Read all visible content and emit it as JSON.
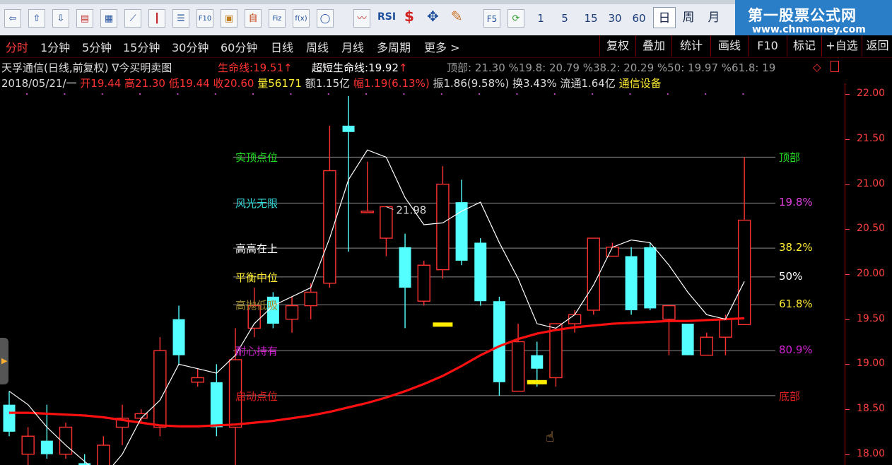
{
  "toolbar": {
    "periods_num": [
      "1",
      "5",
      "15",
      "30",
      "60"
    ],
    "periods_cn": [
      "日",
      "周",
      "月"
    ],
    "rsi_label": "RSI",
    "f5_label": "F5"
  },
  "logo": {
    "title": "第一股票公式网",
    "url": "www.chnmoney.com"
  },
  "periodbar": {
    "items": [
      "分时",
      "1分钟",
      "5分钟",
      "15分钟",
      "30分钟",
      "60分钟",
      "日线",
      "周线",
      "月线",
      "多周期",
      "更多 >"
    ],
    "right": [
      "复权",
      "叠加",
      "统计",
      "画线",
      "F10",
      "标记",
      "+自选",
      "返回"
    ]
  },
  "info1": {
    "name": "天孚通信(日线,前复权)",
    "indicator": "∇今买明卖图",
    "life_label": "生命线:",
    "life_value": "19.51",
    "short_label": "超短生命线:",
    "short_value": "19.92",
    "levels_text": "顶部: 21.30 %19.8: 20.79 %38.2: 20.29 %50: 19.97 %61.8: 19"
  },
  "info2": {
    "date": "2018/05/21/一",
    "open": "开19.44",
    "high": "高21.30",
    "low": "低19.44",
    "close": "收20.60",
    "vol": "量56171",
    "amount": "额1.15亿",
    "change": "幅1.19(6.13%)",
    "amp": "振1.86(9.58%)",
    "turn": "换3.43%",
    "float": "流通1.64亿",
    "sector": "通信设备"
  },
  "axis": {
    "ticks": [
      "22.00",
      "21.50",
      "21.00",
      "20.50",
      "20.00",
      "19.50",
      "19.00",
      "18.50",
      "18.00"
    ]
  },
  "levels": [
    {
      "left": "实顶点位",
      "right": "顶部",
      "price": 21.3,
      "lcolor": "#22dd22",
      "rcolor": "#22dd22"
    },
    {
      "left": "风光无限",
      "right": "19.8%",
      "price": 20.79,
      "lcolor": "#33dddd",
      "rcolor": "#e040e0"
    },
    {
      "left": "高高在上",
      "right": "38.2%",
      "price": 20.29,
      "lcolor": "#ffffff",
      "rcolor": "#ffee33"
    },
    {
      "left": "平衡中位",
      "right": "50%",
      "price": 19.97,
      "lcolor": "#ffee33",
      "rcolor": "#ffffff"
    },
    {
      "left": "高抛低吸",
      "right": "61.8%",
      "price": 19.66,
      "lcolor": "#a08a30",
      "rcolor": "#ffee33"
    },
    {
      "left": "耐心持有",
      "right": "80.9%",
      "price": 19.15,
      "lcolor": "#d020d0",
      "rcolor": "#d020d0"
    },
    {
      "left": "启动点位",
      "right": "底部",
      "price": 18.65,
      "lcolor": "#e02020",
      "rcolor": "#e02020"
    }
  ],
  "peak_label": "21.98",
  "colors": {
    "up": "#ff3232",
    "down": "#54ffff",
    "life": "#ff1010",
    "short": "#ffffff"
  },
  "chart_data": {
    "type": "candlestick",
    "ylim": [
      17.88,
      22.12
    ],
    "candles": [
      [
        18.55,
        18.25,
        18.7,
        18.2
      ],
      [
        18.0,
        18.2,
        18.3,
        17.88
      ],
      [
        18.15,
        18.0,
        18.55,
        17.95
      ],
      [
        18.0,
        18.3,
        18.35,
        17.95
      ],
      [
        17.9,
        17.7,
        18.0,
        17.6
      ],
      [
        17.8,
        18.1,
        18.2,
        17.7
      ],
      [
        18.3,
        18.4,
        18.55,
        18.1
      ],
      [
        18.4,
        18.45,
        18.5,
        18.35
      ],
      [
        18.3,
        19.15,
        19.3,
        18.2
      ],
      [
        19.5,
        19.1,
        19.65,
        19.0
      ],
      [
        18.8,
        18.85,
        18.95,
        18.75
      ],
      [
        18.8,
        18.3,
        19.0,
        18.2
      ],
      [
        18.3,
        19.05,
        19.4,
        17.85
      ],
      [
        19.4,
        19.65,
        19.85,
        19.3
      ],
      [
        19.75,
        19.45,
        19.8,
        19.4
      ],
      [
        19.5,
        19.65,
        19.75,
        19.35
      ],
      [
        19.65,
        19.8,
        19.9,
        19.5
      ],
      [
        19.9,
        21.15,
        21.65,
        19.85
      ],
      [
        21.65,
        21.58,
        21.98,
        20.25
      ],
      [
        20.7,
        20.7,
        21.25,
        20.7
      ],
      [
        20.4,
        20.75,
        20.75,
        20.2
      ],
      [
        20.3,
        19.85,
        20.45,
        19.4
      ],
      [
        19.7,
        20.1,
        20.15,
        19.65
      ],
      [
        20.05,
        21.0,
        21.2,
        19.95
      ],
      [
        20.8,
        20.15,
        21.05,
        20.1
      ],
      [
        20.35,
        19.7,
        20.4,
        19.65
      ],
      [
        19.7,
        18.8,
        19.75,
        18.65
      ],
      [
        18.7,
        19.25,
        19.45,
        18.7
      ],
      [
        19.1,
        18.95,
        19.25,
        18.75
      ],
      [
        18.85,
        19.45,
        19.45,
        18.75
      ],
      [
        19.45,
        19.55,
        19.6,
        19.35
      ],
      [
        19.6,
        20.4,
        20.4,
        19.55
      ],
      [
        20.2,
        20.3,
        20.35,
        20.2
      ],
      [
        20.2,
        19.6,
        20.3,
        19.55
      ],
      [
        20.3,
        19.62,
        20.35,
        19.6
      ],
      [
        19.5,
        19.65,
        19.65,
        19.1
      ],
      [
        19.45,
        19.1,
        19.45,
        19.1
      ],
      [
        19.1,
        19.3,
        19.35,
        19.1
      ],
      [
        19.3,
        19.5,
        19.55,
        19.1
      ],
      [
        19.44,
        20.6,
        21.3,
        19.44
      ]
    ],
    "life_line": [
      18.46,
      18.46,
      18.45,
      18.44,
      18.43,
      18.41,
      18.38,
      18.35,
      18.32,
      18.31,
      18.31,
      18.32,
      18.33,
      18.35,
      18.37,
      18.4,
      18.43,
      18.47,
      18.52,
      18.57,
      18.63,
      18.7,
      18.78,
      18.87,
      18.98,
      19.1,
      19.2,
      19.28,
      19.34,
      19.38,
      19.41,
      19.43,
      19.45,
      19.46,
      19.47,
      19.48,
      19.48,
      19.49,
      19.5,
      19.51
    ],
    "short_line": [
      18.7,
      18.55,
      18.3,
      18.1,
      17.92,
      17.75,
      18.0,
      18.4,
      18.6,
      19.0,
      18.95,
      18.9,
      19.1,
      19.45,
      19.65,
      19.75,
      19.85,
      20.4,
      21.05,
      21.38,
      21.3,
      20.85,
      20.55,
      20.57,
      20.7,
      20.8,
      20.35,
      19.95,
      19.45,
      19.4,
      19.55,
      19.88,
      20.3,
      20.38,
      20.35,
      20.1,
      19.8,
      19.55,
      19.5,
      19.92
    ]
  }
}
